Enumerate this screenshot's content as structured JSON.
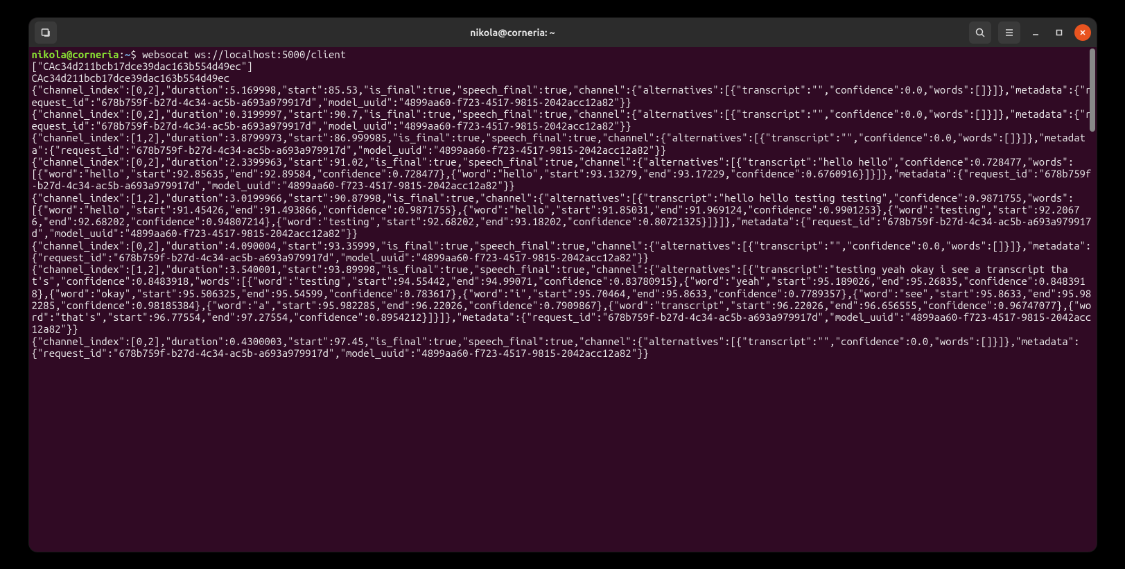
{
  "window": {
    "title": "nikola@corneria: ~"
  },
  "prompt": {
    "user_host": "nikola@corneria",
    "separator": ":",
    "path": "~",
    "dollar": "$",
    "command": "websocat ws://localhost:5000/client"
  },
  "output_lines": [
    "[\"CAc34d211bcb17dce39dac163b554d49ec\"]",
    "CAc34d211bcb17dce39dac163b554d49ec",
    "{\"channel_index\":[0,2],\"duration\":5.169998,\"start\":85.53,\"is_final\":true,\"speech_final\":true,\"channel\":{\"alternatives\":[{\"transcript\":\"\",\"confidence\":0.0,\"words\":[]}]},\"metadata\":{\"request_id\":\"678b759f-b27d-4c34-ac5b-a693a979917d\",\"model_uuid\":\"4899aa60-f723-4517-9815-2042acc12a82\"}}",
    "{\"channel_index\":[0,2],\"duration\":0.3199997,\"start\":90.7,\"is_final\":true,\"speech_final\":true,\"channel\":{\"alternatives\":[{\"transcript\":\"\",\"confidence\":0.0,\"words\":[]}]},\"metadata\":{\"request_id\":\"678b759f-b27d-4c34-ac5b-a693a979917d\",\"model_uuid\":\"4899aa60-f723-4517-9815-2042acc12a82\"}}",
    "{\"channel_index\":[1,2],\"duration\":3.8799973,\"start\":86.999985,\"is_final\":true,\"speech_final\":true,\"channel\":{\"alternatives\":[{\"transcript\":\"\",\"confidence\":0.0,\"words\":[]}]},\"metadata\":{\"request_id\":\"678b759f-b27d-4c34-ac5b-a693a979917d\",\"model_uuid\":\"4899aa60-f723-4517-9815-2042acc12a82\"}}",
    "{\"channel_index\":[0,2],\"duration\":2.3399963,\"start\":91.02,\"is_final\":true,\"speech_final\":true,\"channel\":{\"alternatives\":[{\"transcript\":\"hello hello\",\"confidence\":0.728477,\"words\":[{\"word\":\"hello\",\"start\":92.85635,\"end\":92.89584,\"confidence\":0.728477},{\"word\":\"hello\",\"start\":93.13279,\"end\":93.17229,\"confidence\":0.6760916}]}]},\"metadata\":{\"request_id\":\"678b759f-b27d-4c34-ac5b-a693a979917d\",\"model_uuid\":\"4899aa60-f723-4517-9815-2042acc12a82\"}}",
    "{\"channel_index\":[1,2],\"duration\":3.0199966,\"start\":90.87998,\"is_final\":true,\"channel\":{\"alternatives\":[{\"transcript\":\"hello hello testing testing\",\"confidence\":0.9871755,\"words\":[{\"word\":\"hello\",\"start\":91.45426,\"end\":91.493866,\"confidence\":0.9871755},{\"word\":\"hello\",\"start\":91.85031,\"end\":91.969124,\"confidence\":0.9901253},{\"word\":\"testing\",\"start\":92.20676,\"end\":92.68202,\"confidence\":0.94807214},{\"word\":\"testing\",\"start\":92.68202,\"end\":93.18202,\"confidence\":0.80721325}]}]},\"metadata\":{\"request_id\":\"678b759f-b27d-4c34-ac5b-a693a979917d\",\"model_uuid\":\"4899aa60-f723-4517-9815-2042acc12a82\"}}",
    "{\"channel_index\":[0,2],\"duration\":4.090004,\"start\":93.35999,\"is_final\":true,\"speech_final\":true,\"channel\":{\"alternatives\":[{\"transcript\":\"\",\"confidence\":0.0,\"words\":[]}]},\"metadata\":{\"request_id\":\"678b759f-b27d-4c34-ac5b-a693a979917d\",\"model_uuid\":\"4899aa60-f723-4517-9815-2042acc12a82\"}}",
    "{\"channel_index\":[1,2],\"duration\":3.540001,\"start\":93.89998,\"is_final\":true,\"speech_final\":true,\"channel\":{\"alternatives\":[{\"transcript\":\"testing yeah okay i see a transcript that's\",\"confidence\":0.8483918,\"words\":[{\"word\":\"testing\",\"start\":94.55442,\"end\":94.99071,\"confidence\":0.83780915},{\"word\":\"yeah\",\"start\":95.189026,\"end\":95.26835,\"confidence\":0.8483918},{\"word\":\"okay\",\"start\":95.506325,\"end\":95.54599,\"confidence\":0.783617},{\"word\":\"i\",\"start\":95.70464,\"end\":95.8633,\"confidence\":0.7789357},{\"word\":\"see\",\"start\":95.8633,\"end\":95.982285,\"confidence\":0.98185384},{\"word\":\"a\",\"start\":95.982285,\"end\":96.22026,\"confidence\":0.7909867},{\"word\":\"transcript\",\"start\":96.22026,\"end\":96.656555,\"confidence\":0.96747077},{\"word\":\"that's\",\"start\":96.77554,\"end\":97.27554,\"confidence\":0.8954212}]}]},\"metadata\":{\"request_id\":\"678b759f-b27d-4c34-ac5b-a693a979917d\",\"model_uuid\":\"4899aa60-f723-4517-9815-2042acc12a82\"}}",
    "{\"channel_index\":[0,2],\"duration\":0.4300003,\"start\":97.45,\"is_final\":true,\"speech_final\":true,\"channel\":{\"alternatives\":[{\"transcript\":\"\",\"confidence\":0.0,\"words\":[]}]},\"metadata\":{\"request_id\":\"678b759f-b27d-4c34-ac5b-a693a979917d\",\"model_uuid\":\"4899aa60-f723-4517-9815-2042acc12a82\"}}"
  ]
}
